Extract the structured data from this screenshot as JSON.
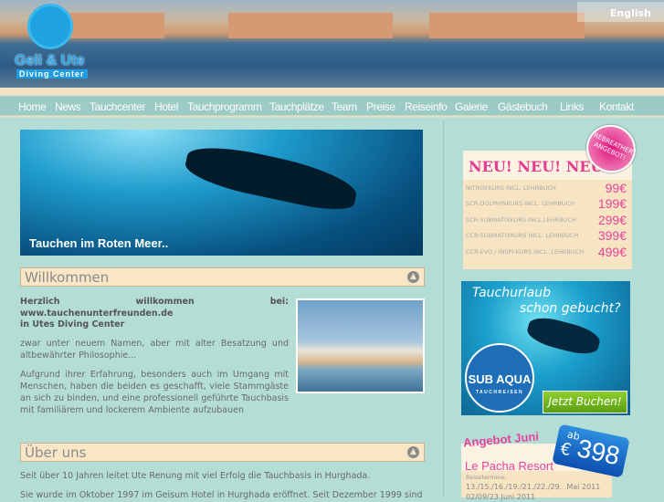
{
  "header": {
    "logo_line1": "Geli & Ute",
    "logo_line2": "Diving Center",
    "language": "English"
  },
  "nav": [
    "Home",
    "News",
    "Tauchcenter",
    "Hotel",
    "Tauchprogramm",
    "Tauchplätze",
    "Team",
    "Preise",
    "Reiseinfo",
    "Galerie",
    "Gästebuch",
    "Links",
    "Kontakt"
  ],
  "hero": {
    "caption": "Tauchen im Roten Meer.."
  },
  "welcome": {
    "title": "Willkommen",
    "intro1": "Herzlich willkommen bei:",
    "intro2": "www.tauchenunterfreunden.de",
    "intro3": "in Utes Diving Center",
    "p1": "zwar unter neuem Namen, aber mit alter Besatzung und altbewährter Philosophie...",
    "p2": "Aufgrund ihrer Erfahrung, besonders auch im Umgang mit Menschen, haben die beiden es geschafft, viele Stammgäste an sich zu binden, und eine professionell geführte Tauchbasis mit familiärem und lockerem Ambiente aufzubauen"
  },
  "about": {
    "title": "Über uns",
    "p1": "Seit über 10 Jahren leitet Ute Renung mit viel Erfolg die Tauchbasis in Hurghada.",
    "p2": "Sie wurde im Oktober 1997 im Geisum Hotel in Hurghada eröffnet. Seit Dezember 1999 sind"
  },
  "prices": {
    "heading": "NEU! NEU! NEU!",
    "badge": "REBREATHER ANGEBOT!",
    "rows": [
      {
        "label": "NITROXKURS INCL. LEHRBUCH",
        "price": "99€"
      },
      {
        "label": "SCR-DOLPHINKURS INCL. LEHRBUCH",
        "price": "199€"
      },
      {
        "label": "SCR-SUBMATIXKURS INCL.LEHRBUCH",
        "price": "299€"
      },
      {
        "label": "CCR-SUBMATIXKURS INCL. LEHRBUCH",
        "price": "399€"
      },
      {
        "label": "CCR-EVO / INSPI-KURS INCL. LEHRBUCH",
        "price": "499€"
      }
    ]
  },
  "ad": {
    "line1": "Tauchurlaub",
    "line2": "schon gebucht?",
    "brand": "SUB AQUA",
    "brand_sub": "TAUCHREISEN",
    "button": "Jetzt Buchen!"
  },
  "offer": {
    "title": "Angebot Juni",
    "hotel": "Le Pacha Resort",
    "label": "Reisetermine:",
    "dates1": "13./15./16./19./21./22./29. .Mai 2011",
    "dates2": "02/09/23 Juni 2011",
    "tag_ab": "ab",
    "tag_currency": "€",
    "tag_amount": "398"
  }
}
